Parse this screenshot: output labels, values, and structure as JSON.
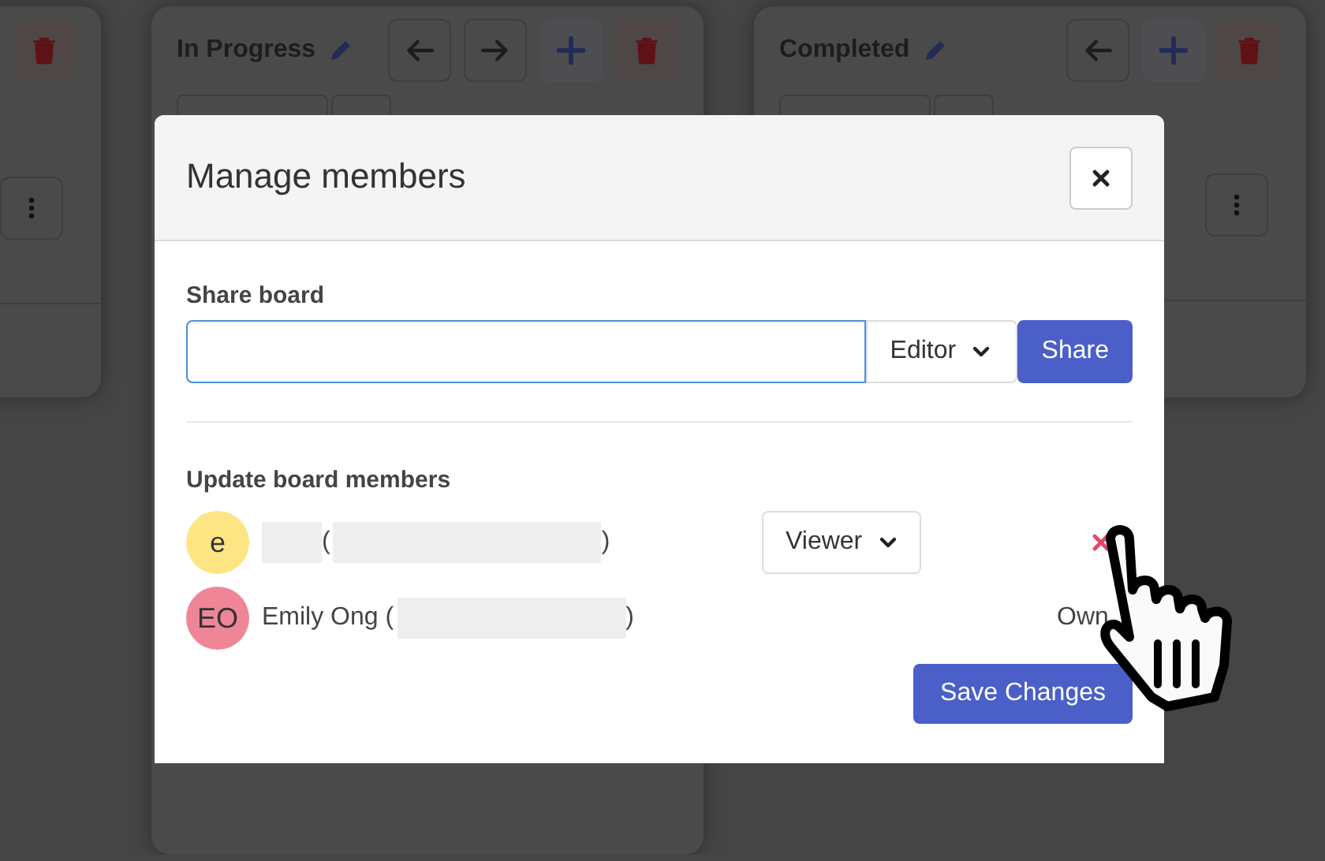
{
  "board": {
    "columns": [
      {
        "buttons": [
          {
            "kind": "delete"
          }
        ],
        "has_menu": true
      },
      {
        "title": "In Progress",
        "buttons": [
          {
            "kind": "left"
          },
          {
            "kind": "right"
          },
          {
            "kind": "add"
          },
          {
            "kind": "delete"
          }
        ],
        "has_menu": false
      },
      {
        "title": "Completed",
        "buttons": [
          {
            "kind": "left"
          },
          {
            "kind": "add"
          },
          {
            "kind": "delete"
          }
        ],
        "has_menu": true
      }
    ]
  },
  "modal": {
    "title": "Manage members",
    "share": {
      "label": "Share board",
      "role": "Editor",
      "button": "Share"
    },
    "members_heading": "Update board members",
    "members": [
      {
        "initials": "e",
        "color": "#fde583",
        "parts": [
          {
            "kind": "redacted-name"
          },
          {
            "kind": "text",
            "text": "("
          },
          {
            "kind": "redacted-email"
          },
          {
            "kind": "text",
            "text": ")"
          }
        ],
        "kind": "select",
        "role": "Viewer",
        "removable": true
      },
      {
        "initials": "EO",
        "color": "#ef8698",
        "parts": [
          {
            "kind": "text",
            "text": "Emily Ong ("
          },
          {
            "kind": "redacted-email-short"
          },
          {
            "kind": "text",
            "text": ")"
          }
        ],
        "kind": "label",
        "role": "Own",
        "removable": false
      }
    ],
    "save_button": "Save Changes"
  }
}
